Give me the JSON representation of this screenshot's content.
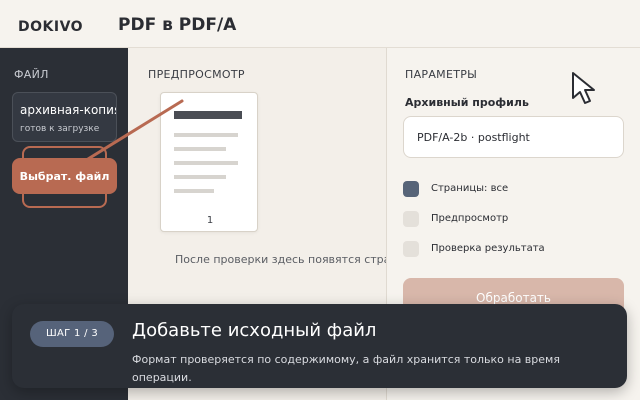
{
  "header": {
    "brand": "DOKIVO",
    "title": "PDF в PDF/A"
  },
  "sidebar": {
    "heading": "ФАЙЛ",
    "file": {
      "name": "архивная-копия.p",
      "status": "готов к загрузке"
    },
    "select_label": "Выбрат. файл"
  },
  "preview": {
    "heading": "ПРЕДПРОСМОТР",
    "page_number": "1",
    "note": "После проверки здесь появятся страни"
  },
  "params": {
    "heading": "ПАРАМЕТРЫ",
    "profile_label": "Архивный профиль",
    "profile_value": "PDF/A-2b · postflight",
    "options": [
      {
        "label": "Страницы: все",
        "checked": true
      },
      {
        "label": "Предпросмотр",
        "checked": false
      },
      {
        "label": "Проверка результата",
        "checked": false
      }
    ],
    "process_label": "Обработать"
  },
  "step": {
    "badge": "ШАГ 1 / 3",
    "title": "Добавьте исходный файл",
    "description": "Формат проверяется по содержимому, а файл хранится только на время операции."
  },
  "colors": {
    "accent": "#b86a52",
    "sidebar_bg": "#2b2f36",
    "checked": "#576478",
    "process_disabled": "#d8b7aa"
  }
}
